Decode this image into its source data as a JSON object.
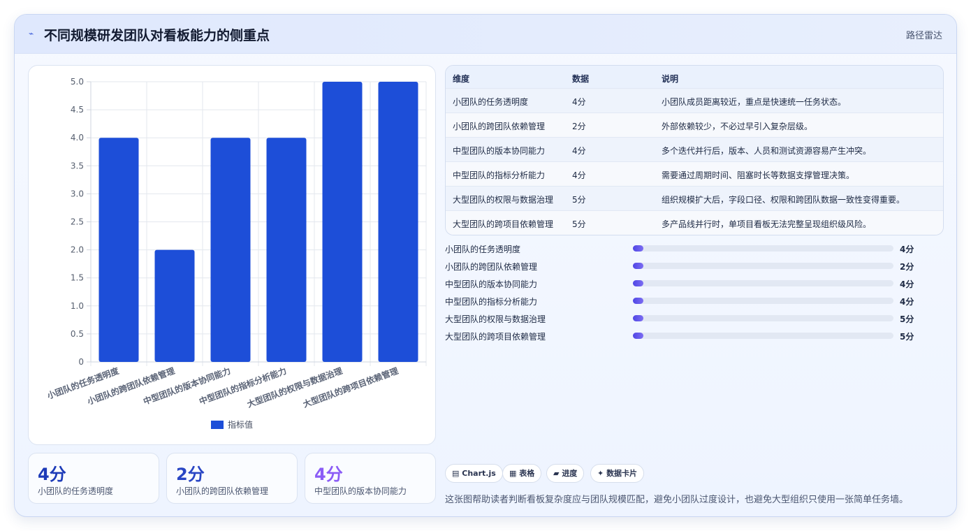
{
  "header": {
    "icon": "trend-line-icon",
    "title": "不同规模研发团队对看板能力的侧重点",
    "tag": "路径雷达"
  },
  "chart_data": {
    "type": "bar",
    "categories": [
      "小团队的任务透明度",
      "小团队的跨团队依赖管理",
      "中型团队的版本协同能力",
      "中型团队的指标分析能力",
      "大型团队的权限与数据治理",
      "大型团队的跨项目依赖管理"
    ],
    "series": [
      {
        "name": "指标值",
        "values": [
          4,
          2,
          4,
          4,
          5,
          5
        ],
        "color": "#1d4ed8"
      }
    ],
    "ylim": [
      0,
      5
    ],
    "yticks": [
      "0",
      "0.5",
      "1.0",
      "1.5",
      "2.0",
      "2.5",
      "3.0",
      "3.5",
      "4.0",
      "4.5",
      "5.0"
    ],
    "grid": true,
    "legend": "bottom"
  },
  "stats": [
    {
      "value": "4分",
      "label": "小团队的任务透明度",
      "color": "#1d3bb8"
    },
    {
      "value": "2分",
      "label": "小团队的跨团队依赖管理",
      "color": "#2946c4"
    },
    {
      "value": "4分",
      "label": "中型团队的版本协同能力",
      "color": "#8b5cf6"
    }
  ],
  "table": {
    "headers": [
      "维度",
      "数据",
      "说明"
    ],
    "rows": [
      [
        "小团队的任务透明度",
        "4分",
        "小团队成员距离较近，重点是快速统一任务状态。"
      ],
      [
        "小团队的跨团队依赖管理",
        "2分",
        "外部依赖较少，不必过早引入复杂层级。"
      ],
      [
        "中型团队的版本协同能力",
        "4分",
        "多个迭代并行后，版本、人员和测试资源容易产生冲突。"
      ],
      [
        "中型团队的指标分析能力",
        "4分",
        "需要通过周期时间、阻塞时长等数据支撑管理决策。"
      ],
      [
        "大型团队的权限与数据治理",
        "5分",
        "组织规模扩大后，字段口径、权限和跨团队数据一致性变得重要。"
      ],
      [
        "大型团队的跨项目依赖管理",
        "5分",
        "多产品线并行时，单项目看板无法完整呈现组织级风险。"
      ]
    ]
  },
  "progress": {
    "max": 5,
    "items": [
      {
        "label": "小团队的任务透明度",
        "value": 4,
        "text": "4分"
      },
      {
        "label": "小团队的跨团队依赖管理",
        "value": 2,
        "text": "2分"
      },
      {
        "label": "中型团队的版本协同能力",
        "value": 4,
        "text": "4分"
      },
      {
        "label": "中型团队的指标分析能力",
        "value": 4,
        "text": "4分"
      },
      {
        "label": "大型团队的权限与数据治理",
        "value": 5,
        "text": "5分"
      },
      {
        "label": "大型团队的跨项目依赖管理",
        "value": 5,
        "text": "5分"
      }
    ]
  },
  "chips": [
    {
      "icon": "chart-icon",
      "glyph": "▤",
      "label": "Chart.js"
    },
    {
      "icon": "table-icon",
      "glyph": "▦",
      "label": "表格"
    },
    {
      "icon": "progress-icon",
      "glyph": "▰",
      "label": "进度"
    },
    {
      "icon": "sparkle-icon",
      "glyph": "✦",
      "label": "数据卡片"
    }
  ],
  "note": "这张图帮助读者判断看板复杂度应与团队规模匹配，避免小团队过度设计，也避免大型组织只使用一张简单任务墙。"
}
